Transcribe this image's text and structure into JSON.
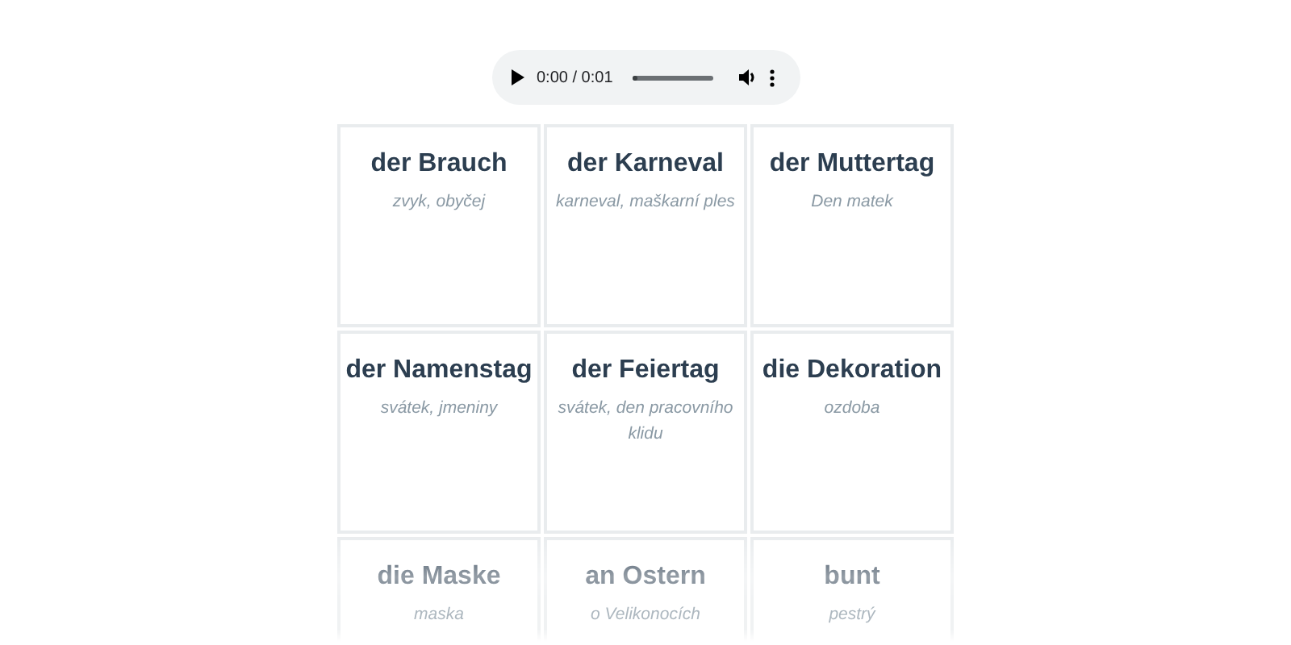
{
  "audio_player": {
    "time": "0:00 / 0:01",
    "level": 0
  },
  "cards": [
    {
      "word": "der Brauch",
      "translation": "zvyk, obyčej"
    },
    {
      "word": "der Karneval",
      "translation": "karneval, maškarní ples"
    },
    {
      "word": "der Muttertag",
      "translation": "Den matek"
    },
    {
      "word": "der Namenstag",
      "translation": "svátek, jmeniny"
    },
    {
      "word": "der Feiertag",
      "translation": "svátek, den pracovního klidu"
    },
    {
      "word": "die Dekoration",
      "translation": "ozdoba"
    },
    {
      "word": "die Maske",
      "translation": "maska"
    },
    {
      "word": "an Ostern",
      "translation": "o Velikonocích"
    },
    {
      "word": "bunt",
      "translation": "pestrý"
    }
  ]
}
